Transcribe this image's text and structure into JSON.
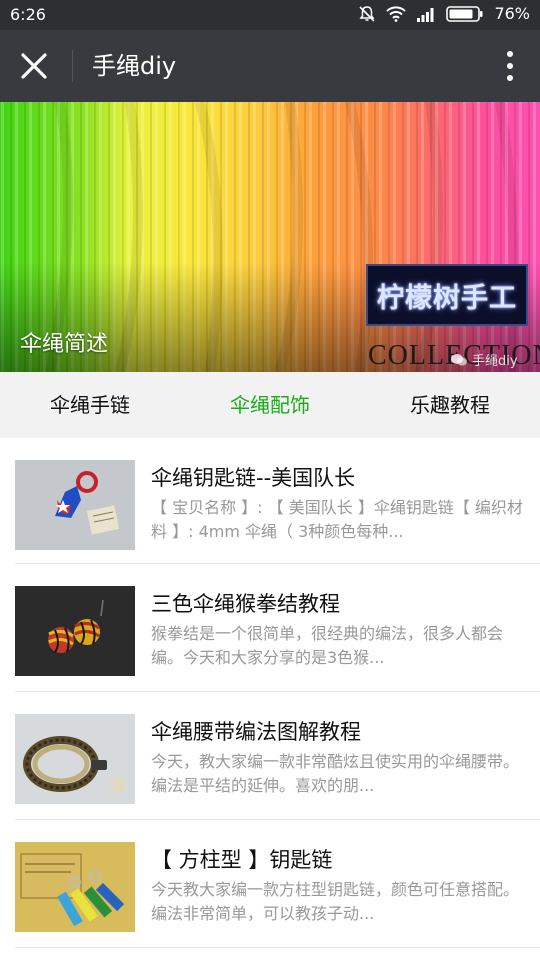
{
  "status_bar": {
    "time": "6:26",
    "battery": "76%",
    "icons": [
      "mute-icon",
      "wifi-icon",
      "signal-icon",
      "battery-icon"
    ]
  },
  "title_bar": {
    "title": "手绳diy",
    "close_icon": "close-icon",
    "more_icon": "more-vertical-icon"
  },
  "banner": {
    "caption": "伞绳简述",
    "logo_text": "柠檬树手工",
    "collection_text": "COLLECTION",
    "watermark": "手绳diy"
  },
  "tabs": [
    {
      "label": "伞绳手链",
      "active": false
    },
    {
      "label": "伞绳配饰",
      "active": true
    },
    {
      "label": "乐趣教程",
      "active": false
    }
  ],
  "articles": [
    {
      "title": "伞绳钥匙链--美国队长",
      "desc": "【 宝贝名称 】: 【 美国队长 】伞绳钥匙链【 编织材料 】: 4mm 伞绳（ 3种颜色每种..."
    },
    {
      "title": "三色伞绳猴拳结教程",
      "desc": "猴拳结是一个很简单，很经典的编法，很多人都会编。今天和大家分享的是3色猴..."
    },
    {
      "title": "伞绳腰带编法图解教程",
      "desc": "今天，教大家编一款非常酷炫且使实用的伞绳腰带。编法是平结的延伸。喜欢的朋..."
    },
    {
      "title": "【 方柱型 】钥匙链",
      "desc": "今天教大家编一款方柱型钥匙链，颜色可任意搭配。编法非常简单，可以教孩子动..."
    }
  ],
  "colors": {
    "active_tab": "#1aad19",
    "title_bar": "#393a3f",
    "status_bar": "#2e2f31"
  }
}
